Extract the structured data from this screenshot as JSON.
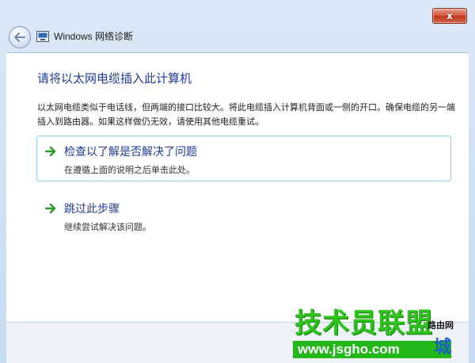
{
  "window": {
    "title": "Windows 网络诊断",
    "close_label": "x"
  },
  "main": {
    "heading": "请将以太网电缆插入此计算机",
    "description": "以太网电缆类似于电话线，但两端的接口比较大。将此电缆插入计算机背面或一侧的开口。确保电缆的另一端插入到路由器。如果这样做仍无效，请使用其他电缆重试。",
    "options": [
      {
        "title": "检查以了解是否解决了问题",
        "subtitle": "在遵循上面的说明之后单击此处。",
        "selected": true
      },
      {
        "title": "跳过此步骤",
        "subtitle": "继续尝试解决该问题。",
        "selected": false
      }
    ]
  },
  "watermark": {
    "main": "技术员联盟",
    "side": "路由网",
    "url": "www.jsgho.com",
    "extra": "城"
  },
  "colors": {
    "accent": "#1f3b9b",
    "selection_border": "#9ad6ec",
    "arrow_green": "#2a9a27",
    "close_red": "#c0391e"
  }
}
